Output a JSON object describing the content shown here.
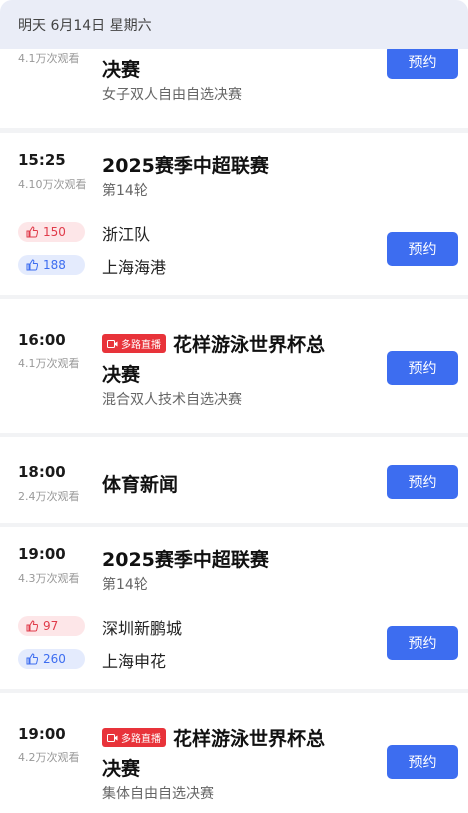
{
  "header": {
    "date_label": "明天 6月14日 星期六"
  },
  "book_label": "预约",
  "live_badge_label": "多路直播",
  "events": [
    {
      "views": "4.1万次观看",
      "title": "决赛",
      "subtitle": "女子双人自由自选决赛"
    },
    {
      "time": "15:25",
      "views": "4.10万次观看",
      "title": "2025赛季中超联赛",
      "subtitle": "第14轮",
      "home": {
        "team": "浙江队",
        "likes": "150"
      },
      "away": {
        "team": "上海海港",
        "likes": "188"
      }
    },
    {
      "time": "16:00",
      "views": "4.1万次观看",
      "title": "花样游泳世界杯总",
      "title_cont": "决赛",
      "subtitle": "混合双人技术自选决赛"
    },
    {
      "time": "18:00",
      "views": "2.4万次观看",
      "title": "体育新闻"
    },
    {
      "time": "19:00",
      "views": "4.3万次观看",
      "title": "2025赛季中超联赛",
      "subtitle": "第14轮",
      "home": {
        "team": "深圳新鹏城",
        "likes": "97"
      },
      "away": {
        "team": "上海申花",
        "likes": "260"
      }
    },
    {
      "time": "19:00",
      "views": "4.2万次观看",
      "title": "花样游泳世界杯总",
      "title_cont": "决赛",
      "subtitle": "集体自由自选决赛"
    }
  ],
  "colors": {
    "accent": "#3d6df0",
    "live": "#e8333a",
    "like_red": "#e03b4a",
    "header_bg": "#eaedf7"
  },
  "icons": {
    "like": "thumbs-up-icon",
    "live": "video-camera-icon"
  }
}
